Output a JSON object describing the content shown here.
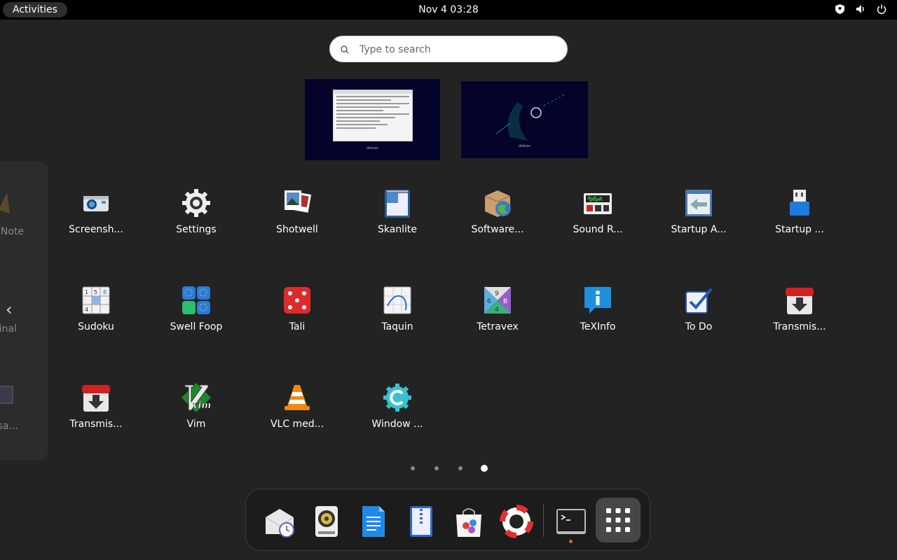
{
  "topbar": {
    "activities": "Activities",
    "clock": "Nov 4  03:28"
  },
  "search": {
    "placeholder": "Type to search"
  },
  "workspaces": {
    "ws1_watermark": "debian",
    "ws2_watermark": "debian"
  },
  "side_panel": {
    "labels": [
      "Note",
      "inal",
      "isa..."
    ]
  },
  "apps": [
    {
      "label": "Screensh...",
      "icon": "screenshot-icon"
    },
    {
      "label": "Settings",
      "icon": "settings-gear-icon"
    },
    {
      "label": "Shotwell",
      "icon": "shotwell-photos-icon"
    },
    {
      "label": "Skanlite",
      "icon": "skanlite-scanner-icon"
    },
    {
      "label": "Software...",
      "icon": "software-package-icon"
    },
    {
      "label": "Sound R...",
      "icon": "sound-recorder-icon"
    },
    {
      "label": "Startup A...",
      "icon": "startup-applications-icon"
    },
    {
      "label": "Startup ...",
      "icon": "startup-disk-usb-icon"
    },
    {
      "label": "Sudoku",
      "icon": "sudoku-icon"
    },
    {
      "label": "Swell Foop",
      "icon": "swell-foop-icon"
    },
    {
      "label": "Tali",
      "icon": "tali-dice-icon"
    },
    {
      "label": "Taquin",
      "icon": "taquin-icon"
    },
    {
      "label": "Tetravex",
      "icon": "tetravex-icon"
    },
    {
      "label": "TeXInfo",
      "icon": "texinfo-icon"
    },
    {
      "label": "To Do",
      "icon": "todo-checkbox-icon"
    },
    {
      "label": "Transmis...",
      "icon": "transmission-icon"
    },
    {
      "label": "Transmis...",
      "icon": "transmission-icon"
    },
    {
      "label": "Vim",
      "icon": "vim-icon"
    },
    {
      "label": "VLC med...",
      "icon": "vlc-cone-icon"
    },
    {
      "label": "Window ...",
      "icon": "window-compiz-icon"
    }
  ],
  "pager": {
    "pages": 4,
    "active_page": 4
  },
  "dock": {
    "items": [
      "evolution-mail-icon",
      "rhythmbox-icon",
      "writer-document-icon",
      "file-archive-icon",
      "software-store-icon",
      "help-lifebuoy-icon",
      "terminal-icon",
      "show-apps-grid-icon"
    ]
  },
  "colors": {
    "background": "#232323",
    "topbar": "#000000",
    "accent_running": "#e35d2c"
  }
}
